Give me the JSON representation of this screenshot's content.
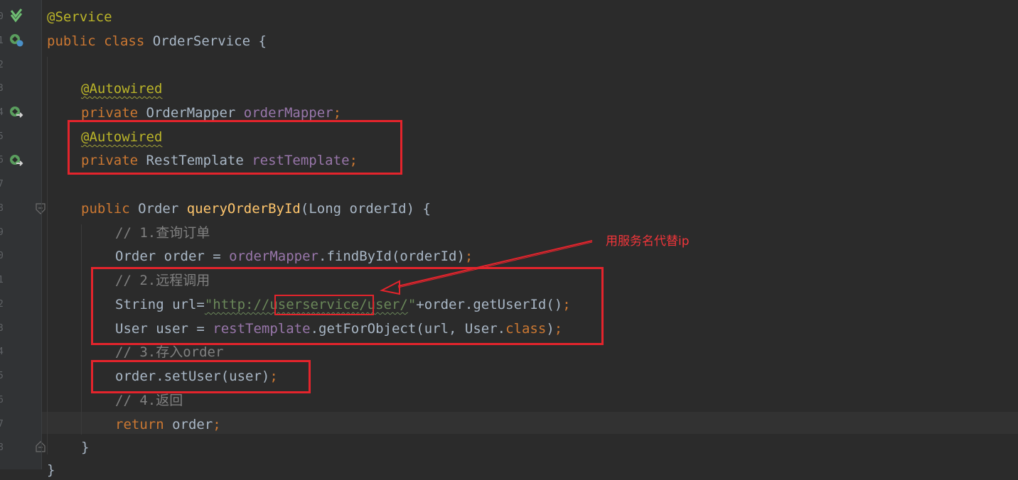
{
  "gutter": {
    "line_numbers": [
      "0",
      "1",
      "2",
      "3",
      "4",
      "5",
      "6",
      "7",
      "8",
      "9",
      "0",
      "1",
      "2",
      "3",
      "4",
      "5",
      "6",
      "7",
      "8"
    ]
  },
  "code": {
    "service_annotation": "@Service",
    "class_kw_public": "public",
    "class_kw_class": "class",
    "class_name_decl": " OrderService {",
    "autowired_1": "@Autowired",
    "private_1": "private",
    "type_1": " OrderMapper ",
    "field_1": "orderMapper",
    "semi": ";",
    "autowired_2": "@Autowired",
    "private_2": "private",
    "type_2": " RestTemplate ",
    "field_2": "restTemplate",
    "method_public": "public",
    "method_type": " Order ",
    "method_name": "queryOrderById",
    "method_params": "(Long orderId) {",
    "comment_1": "// 1.查询订单",
    "l11_type": "Order order = ",
    "l11_field": "orderMapper",
    "l11_call": ".findById(orderId)",
    "comment_2": "// 2.远程调用",
    "l13_decl": "String url=",
    "l13_str_a": "\"http://",
    "l13_str_b": "userservice",
    "l13_str_c": "/user/",
    "l13_str_d": "\"",
    "l13_rest": "+order.getUserId()",
    "l14_decl": "User user = ",
    "l14_field": "restTemplate",
    "l14_call": ".getForObject(url, User.",
    "l14_class_kw": "class",
    "l14_close": ")",
    "comment_3": "// 3.存入order",
    "l16_call": "order.setUser(user)",
    "comment_4": "// 4.返回",
    "return_kw": "return",
    "return_val": " order",
    "close_method": "}",
    "close_class": "}"
  },
  "annotation_note": "用服务名代替ip",
  "colors": {
    "background": "#2b2b2b",
    "keyword": "#cc7832",
    "annotation": "#bbb529",
    "field": "#9876aa",
    "method": "#ffc66d",
    "string": "#6a8759",
    "comment": "#808080",
    "highlight_box": "#e4242c"
  },
  "icons": [
    "spring-bean-icon",
    "spring-bean-navigate-icon",
    "autowired-navigate-icon",
    "fold-icon"
  ]
}
